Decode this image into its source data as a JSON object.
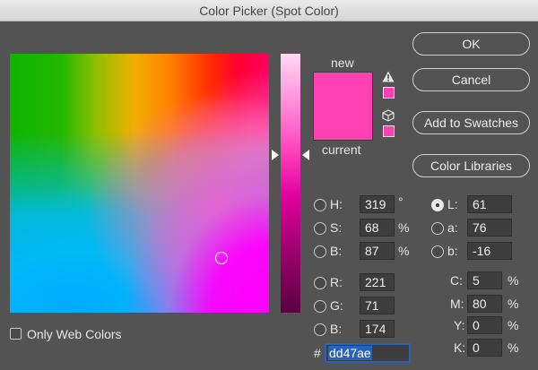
{
  "window": {
    "title": "Color Picker (Spot Color)"
  },
  "preview": {
    "new_label": "new",
    "current_label": "current",
    "new_color": "#ff40b2",
    "current_color": "#ff40b2"
  },
  "buttons": {
    "ok": "OK",
    "cancel": "Cancel",
    "add_to_swatches": "Add to Swatches",
    "color_libraries": "Color Libraries"
  },
  "hsb": {
    "h": {
      "label": "H:",
      "value": "319",
      "unit": "°"
    },
    "s": {
      "label": "S:",
      "value": "68",
      "unit": "%"
    },
    "b": {
      "label": "B:",
      "value": "87",
      "unit": "%"
    }
  },
  "rgb": {
    "r": {
      "label": "R:",
      "value": "221"
    },
    "g": {
      "label": "G:",
      "value": "71"
    },
    "b": {
      "label": "B:",
      "value": "174"
    }
  },
  "lab": {
    "l": {
      "label": "L:",
      "value": "61",
      "selected": true
    },
    "a": {
      "label": "a:",
      "value": "76"
    },
    "b": {
      "label": "b:",
      "value": "-16"
    }
  },
  "cmyk": {
    "c": {
      "label": "C:",
      "value": "5",
      "unit": "%"
    },
    "m": {
      "label": "M:",
      "value": "80",
      "unit": "%"
    },
    "y": {
      "label": "Y:",
      "value": "0",
      "unit": "%"
    },
    "k": {
      "label": "K:",
      "value": "0",
      "unit": "%"
    }
  },
  "hex": {
    "label": "#",
    "value": "dd47ae"
  },
  "only_web_colors": {
    "label": "Only Web Colors",
    "checked": false
  },
  "icons": {
    "gamut_warning": "warning-icon",
    "web_safe": "cube-icon"
  }
}
